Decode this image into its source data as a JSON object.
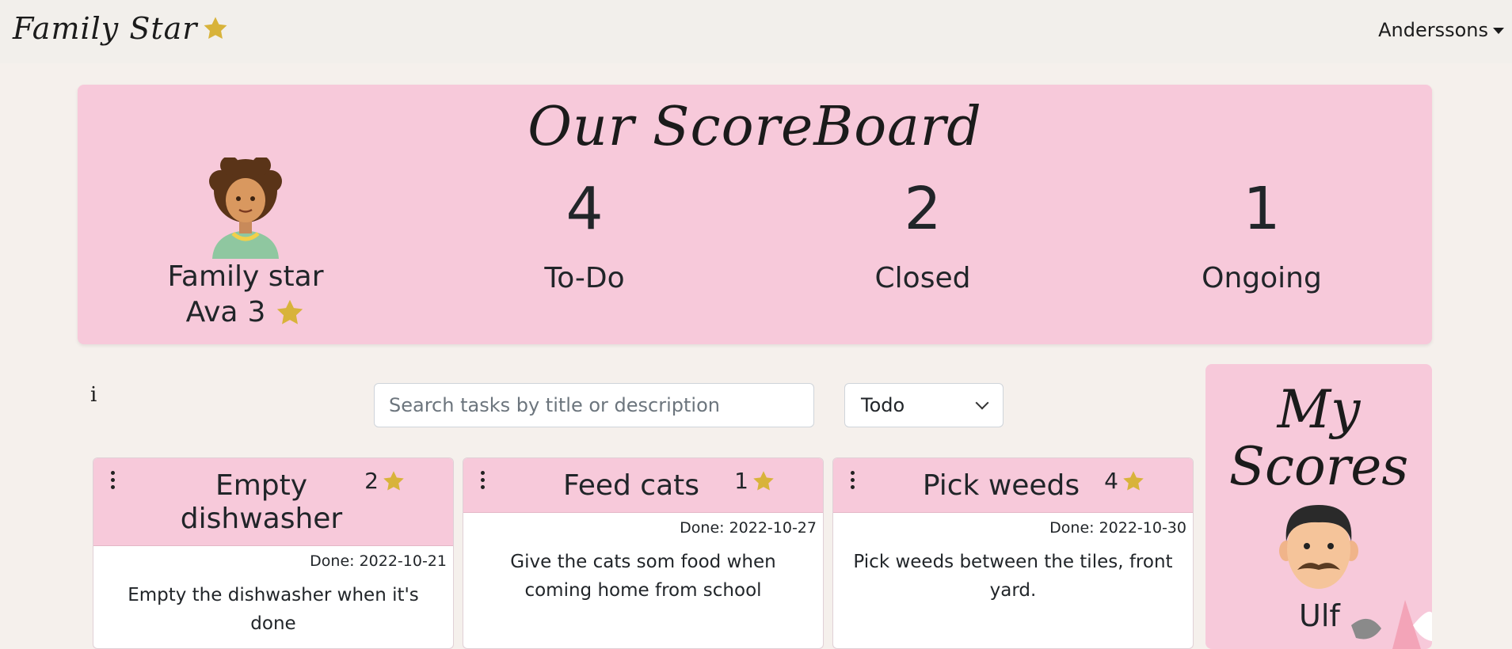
{
  "nav": {
    "brand": "Family Star",
    "family_menu": "Anderssons"
  },
  "scoreboard": {
    "title": "Our ScoreBoard",
    "family_star_label": "Family star",
    "star_name": "Ava",
    "star_score": "3",
    "stats": [
      {
        "value": "4",
        "label": "To-Do"
      },
      {
        "value": "2",
        "label": "Closed"
      },
      {
        "value": "1",
        "label": "Ongoing"
      }
    ]
  },
  "toolbar": {
    "info": "i",
    "search_placeholder": "Search tasks by title or description",
    "filter_selected": "Todo"
  },
  "tasks": [
    {
      "title": "Empty dishwasher",
      "score": "2",
      "done": "Done: 2022-10-21",
      "description": "Empty the dishwasher when it's done"
    },
    {
      "title": "Feed cats",
      "score": "1",
      "done": "Done: 2022-10-27",
      "description": "Give the cats som food when coming home from school"
    },
    {
      "title": "Pick weeds",
      "score": "4",
      "done": "Done: 2022-10-30",
      "description": "Pick weeds between the tiles, front yard."
    }
  ],
  "my_scores": {
    "title": "My Scores",
    "name": "Ulf"
  },
  "colors": {
    "accent_pink": "#f7c9da",
    "star_gold": "#d8b33a",
    "page_bg": "#f5f0ec"
  }
}
